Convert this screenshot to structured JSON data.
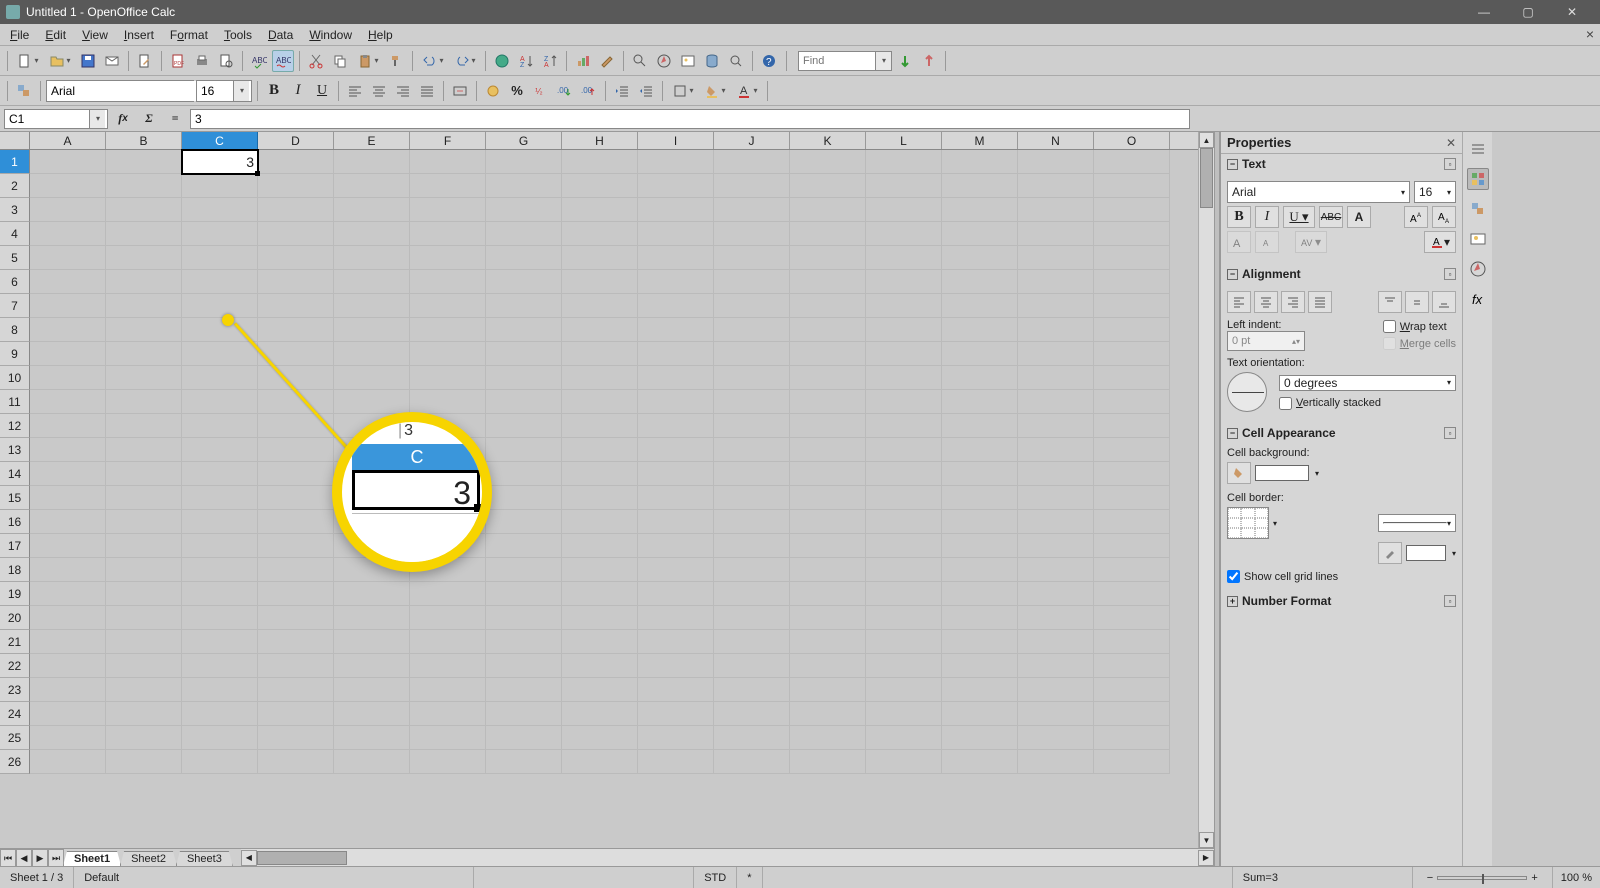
{
  "title": "Untitled 1 - OpenOffice Calc",
  "menus": [
    "File",
    "Edit",
    "View",
    "Insert",
    "Format",
    "Tools",
    "Data",
    "Window",
    "Help"
  ],
  "find_placeholder": "Find",
  "font_name": "Arial",
  "font_size": "16",
  "name_box": "C1",
  "formula": "3",
  "columns": [
    "A",
    "B",
    "C",
    "D",
    "E",
    "F",
    "G",
    "H",
    "I",
    "J",
    "K",
    "L",
    "M",
    "N",
    "O"
  ],
  "selected_col": "C",
  "selected_row": 1,
  "cell_value": "3",
  "row_count": 26,
  "sheets": [
    "Sheet1",
    "Sheet2",
    "Sheet3"
  ],
  "active_sheet": 0,
  "status": {
    "sheet": "Sheet 1 / 3",
    "style": "Default",
    "mode": "STD",
    "modified": "*",
    "sum": "Sum=3",
    "zoom": "100 %"
  },
  "props": {
    "title": "Properties",
    "text": {
      "label": "Text",
      "font": "Arial",
      "size": "16"
    },
    "alignment": {
      "label": "Alignment",
      "indent_label": "Left indent:",
      "indent": "0 pt",
      "wrap": "Wrap text",
      "merge": "Merge cells",
      "orient_label": "Text orientation:",
      "orient": "0 degrees",
      "vstack": "Vertically stacked"
    },
    "appearance": {
      "label": "Cell Appearance",
      "bg": "Cell background:",
      "border": "Cell border:",
      "grid": "Show cell grid lines"
    },
    "numfmt": {
      "label": "Number Format"
    }
  },
  "magnifier": {
    "col": "C",
    "formula": "3",
    "value": "3"
  }
}
